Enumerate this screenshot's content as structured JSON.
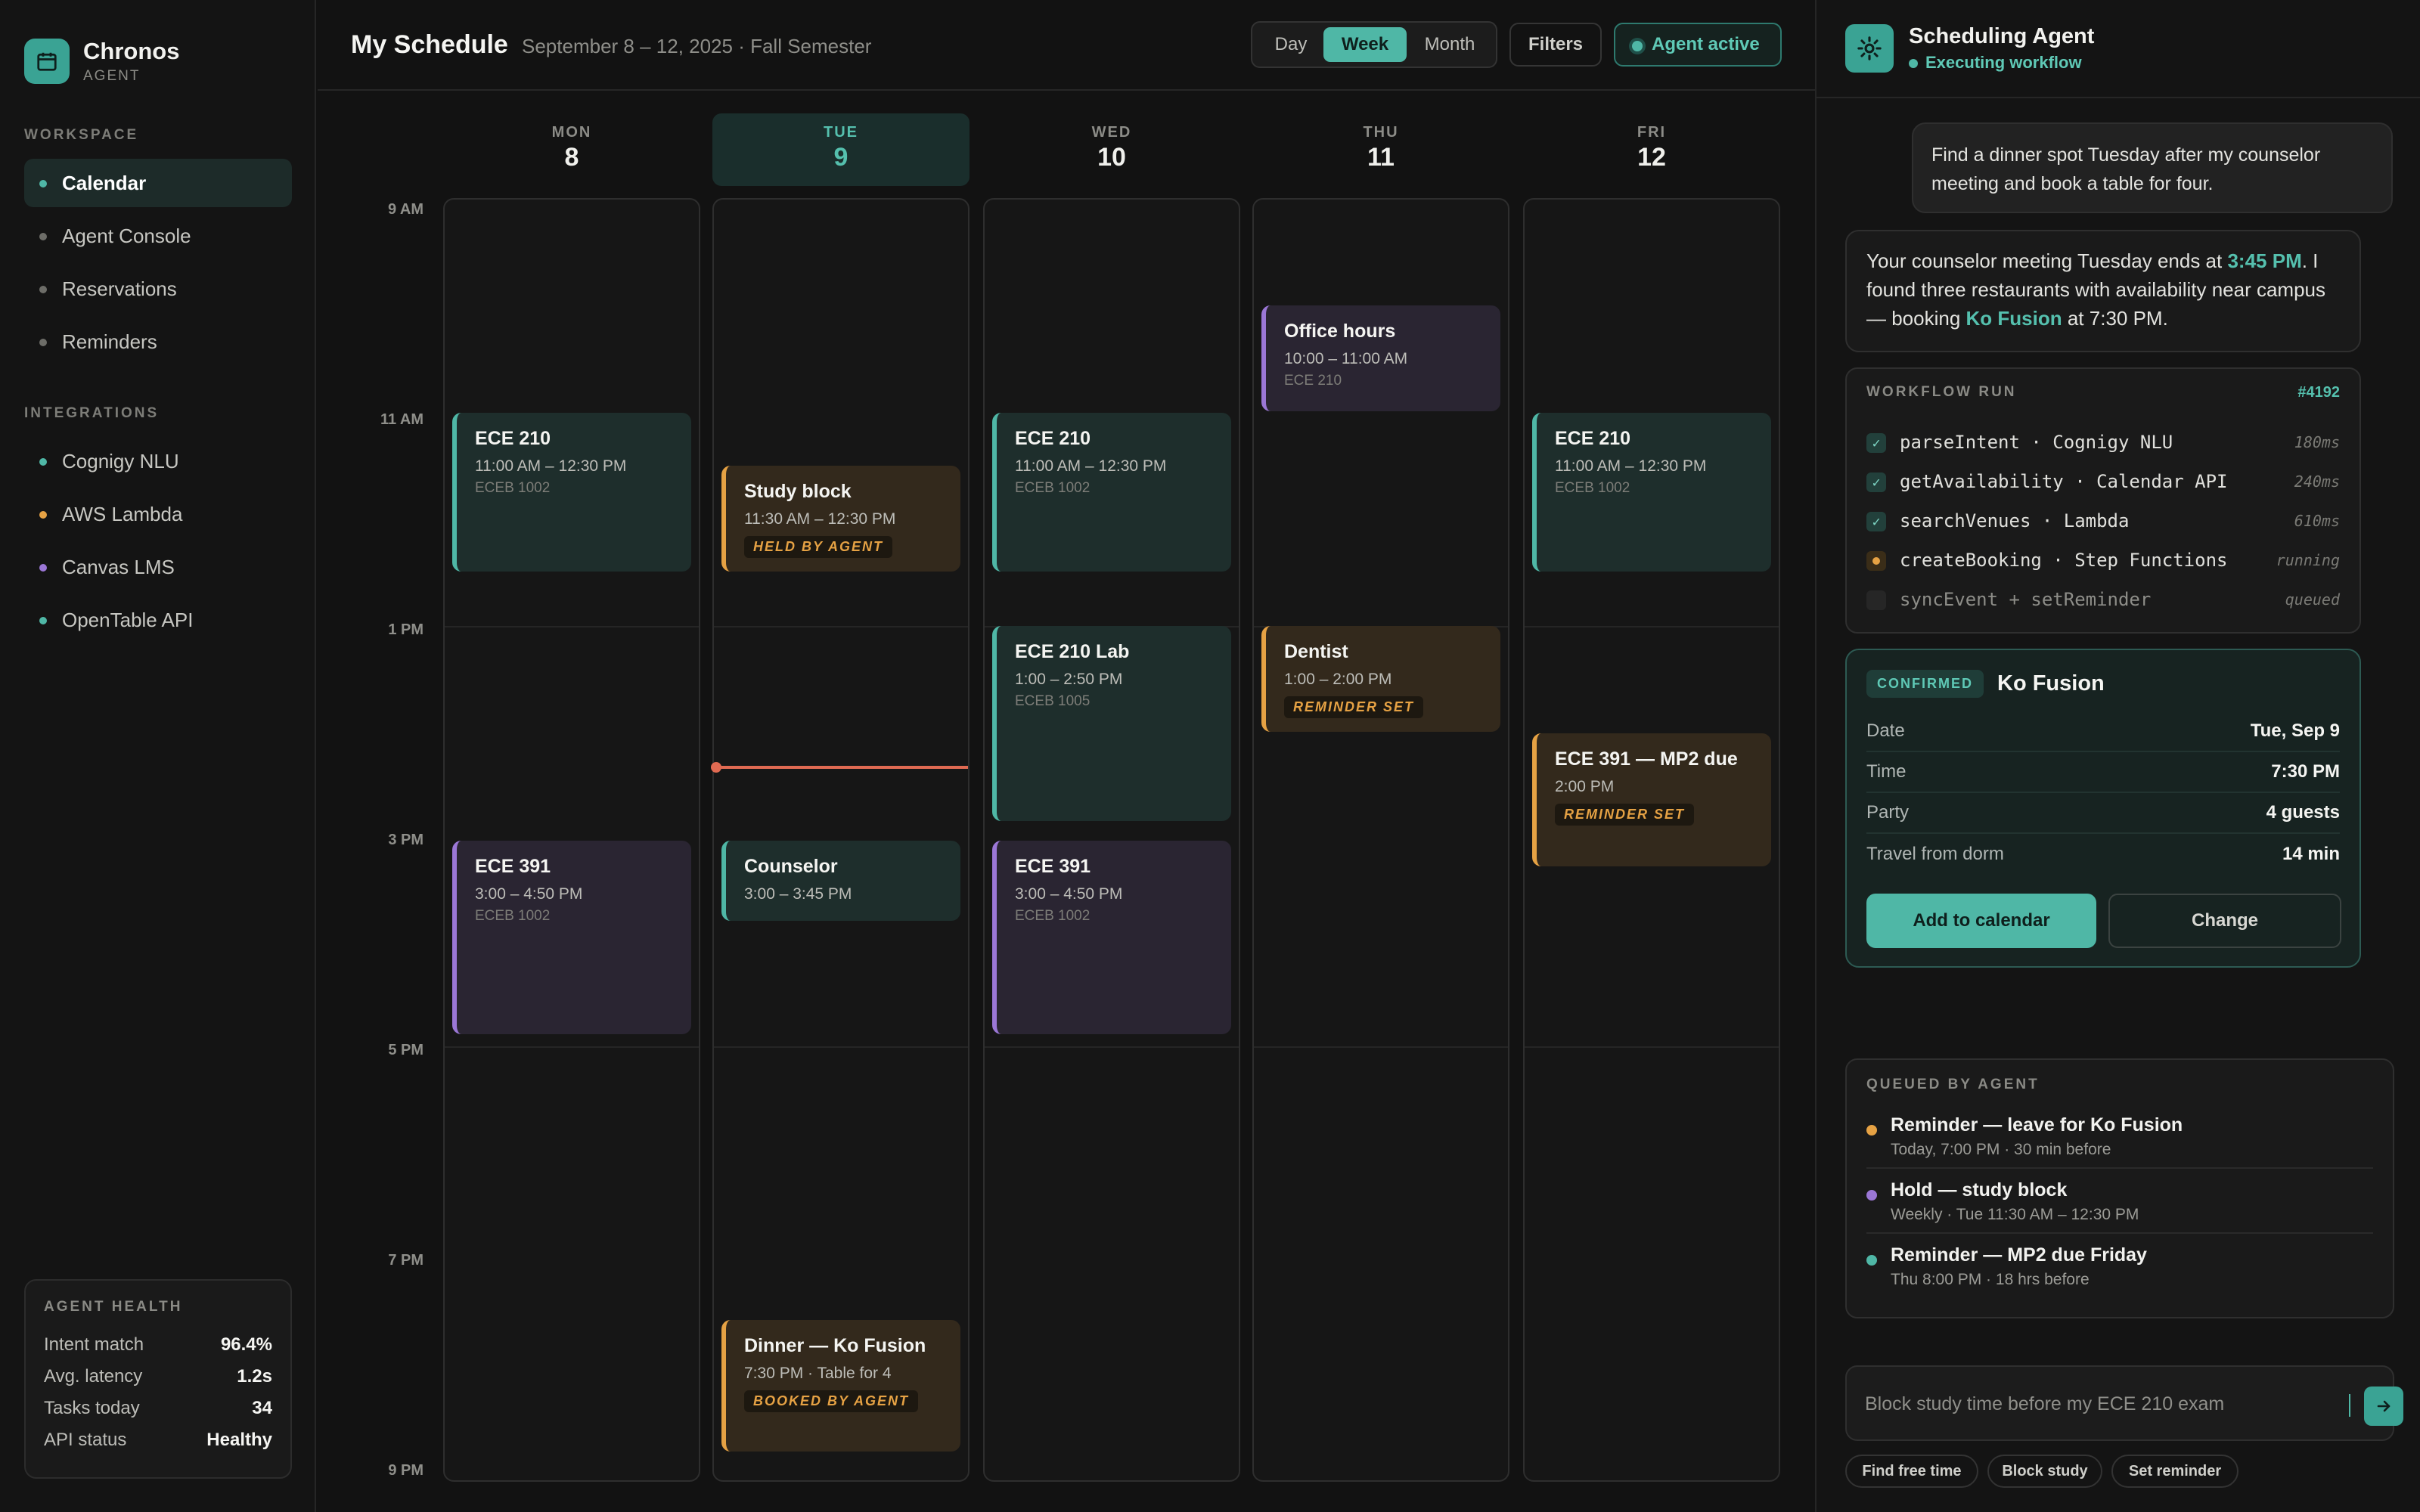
{
  "brand": {
    "name": "Chronos",
    "sub": "AGENT"
  },
  "sidebar": {
    "workspace_label": "WORKSPACE",
    "workspace": [
      {
        "label": "Calendar"
      },
      {
        "label": "Agent Console"
      },
      {
        "label": "Reservations"
      },
      {
        "label": "Reminders"
      }
    ],
    "integrations_label": "INTEGRATIONS",
    "integrations": [
      {
        "label": "Cognigy NLU",
        "color": "#4fb7a6"
      },
      {
        "label": "AWS Lambda",
        "color": "#e6a244"
      },
      {
        "label": "Canvas LMS",
        "color": "#9b77d6"
      },
      {
        "label": "OpenTable API",
        "color": "#4fb7a6"
      }
    ],
    "health": {
      "title": "AGENT HEALTH",
      "rows": [
        {
          "label": "Intent match",
          "value": "96.4%"
        },
        {
          "label": "Avg. latency",
          "value": "1.2s"
        },
        {
          "label": "Tasks today",
          "value": "34"
        },
        {
          "label": "API status",
          "value": "Healthy"
        }
      ]
    }
  },
  "header": {
    "title": "My Schedule",
    "subtitle": "September 8 – 12, 2025 · Fall Semester",
    "views": [
      "Day",
      "Week",
      "Month"
    ],
    "active_view": "Week",
    "filters_label": "Filters",
    "agent_pill": "Agent active"
  },
  "calendar": {
    "days": [
      {
        "name": "MON",
        "num": "8"
      },
      {
        "name": "TUE",
        "num": "9"
      },
      {
        "name": "WED",
        "num": "10"
      },
      {
        "name": "THU",
        "num": "11"
      },
      {
        "name": "FRI",
        "num": "12"
      }
    ],
    "today_index": 1,
    "time_labels": [
      "9 AM",
      "11 AM",
      "1 PM",
      "3 PM",
      "5 PM",
      "7 PM",
      "9 PM"
    ],
    "now_time": "2:40 PM",
    "events": {
      "mon_ece210": {
        "title": "ECE 210",
        "time": "11:00 AM – 12:30 PM",
        "loc": "ECEB 1002"
      },
      "mon_ece391": {
        "title": "ECE 391",
        "time": "3:00 – 4:50 PM",
        "loc": "ECEB 1002"
      },
      "tue_study": {
        "title": "Study block",
        "time": "11:30 AM – 12:30 PM",
        "badge": "HELD BY AGENT"
      },
      "tue_counselor": {
        "title": "Counselor",
        "time": "3:00 – 3:45 PM"
      },
      "tue_dinner": {
        "title": "Dinner — Ko Fusion",
        "time": "7:30 PM · Table for 4",
        "badge": "BOOKED BY AGENT"
      },
      "wed_ece210": {
        "title": "ECE 210",
        "time": "11:00 AM – 12:30 PM",
        "loc": "ECEB 1002"
      },
      "wed_lab": {
        "title": "ECE 210 Lab",
        "time": "1:00 – 2:50 PM",
        "loc": "ECEB 1005"
      },
      "wed_ece391": {
        "title": "ECE 391",
        "time": "3:00 – 4:50 PM",
        "loc": "ECEB 1002"
      },
      "thu_office": {
        "title": "Office hours",
        "time": "10:00 – 11:00 AM",
        "loc": "ECE 210"
      },
      "thu_dentist": {
        "title": "Dentist",
        "time": "1:00 – 2:00 PM",
        "badge": "REMINDER SET"
      },
      "fri_ece210": {
        "title": "ECE 210",
        "time": "11:00 AM – 12:30 PM",
        "loc": "ECEB 1002"
      },
      "fri_mp2": {
        "title": "ECE 391 — MP2 due",
        "time": "2:00 PM",
        "badge": "REMINDER SET"
      }
    }
  },
  "agent": {
    "title": "Scheduling Agent",
    "status": "Executing workflow",
    "user_message": "Find a dinner spot Tuesday after my counselor meeting and book a table for four.",
    "reply": {
      "part1": "Your counselor meeting Tuesday ends at ",
      "time": "3:45 PM",
      "part2": ". I found three restaurants with availability near campus — booking ",
      "venue": "Ko Fusion",
      "part3": " at 7:30 PM."
    },
    "workflow": {
      "label": "WORKFLOW RUN",
      "run_id": "#4192",
      "steps": [
        {
          "name": "parseIntent · Cognigy NLU",
          "duration": "180ms",
          "state": "done"
        },
        {
          "name": "getAvailability · Calendar API",
          "duration": "240ms",
          "state": "done"
        },
        {
          "name": "searchVenues · Lambda",
          "duration": "610ms",
          "state": "done"
        },
        {
          "name": "createBooking · Step Functions",
          "duration": "running",
          "state": "running"
        },
        {
          "name": "syncEvent + setReminder",
          "duration": "queued",
          "state": "queued"
        }
      ]
    },
    "confirmation": {
      "badge": "CONFIRMED",
      "venue": "Ko Fusion",
      "rows": [
        {
          "label": "Date",
          "value": "Tue, Sep 9"
        },
        {
          "label": "Time",
          "value": "7:30 PM"
        },
        {
          "label": "Party",
          "value": "4 guests"
        },
        {
          "label": "Travel from dorm",
          "value": "14 min"
        }
      ],
      "primary": "Add to calendar",
      "secondary": "Change"
    },
    "queue": {
      "label": "QUEUED BY AGENT",
      "items": [
        {
          "title": "Reminder — leave for Ko Fusion",
          "sub": "Today, 7:00 PM · 30 min before",
          "color": "#e6a244"
        },
        {
          "title": "Hold — study block",
          "sub": "Weekly · Tue 11:30 AM – 12:30 PM",
          "color": "#9b77d6"
        },
        {
          "title": "Reminder — MP2 due Friday",
          "sub": "Thu 8:00 PM · 18 hrs before",
          "color": "#4fb7a6"
        }
      ]
    },
    "input_placeholder": "Block study time before my ECE 210 exam",
    "chips": [
      "Find free time",
      "Block study",
      "Set reminder"
    ]
  }
}
